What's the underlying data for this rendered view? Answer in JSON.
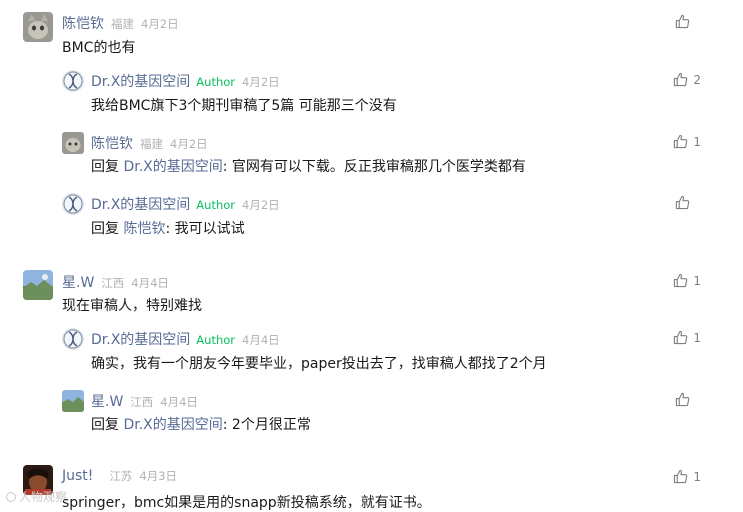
{
  "comments": [
    {
      "name": "陈恺钦",
      "location": "福建",
      "date": "4月2日",
      "text": "BMC的也有",
      "likes": "",
      "replies": [
        {
          "name": "Dr.X的基因空间",
          "author": "Author",
          "date": "4月2日",
          "text": "我给BMC旗下3个期刊审稿了5篇 可能那三个没有",
          "likes": "2"
        },
        {
          "name": "陈恺钦",
          "location": "福建",
          "date": "4月2日",
          "reply_prefix": "回复 ",
          "reply_to": "Dr.X的基因空间",
          "text": ": 官网有可以下载。反正我审稿那几个医学类都有",
          "likes": "1"
        },
        {
          "name": "Dr.X的基因空间",
          "author": "Author",
          "date": "4月2日",
          "reply_prefix": "回复 ",
          "reply_to": "陈恺钦",
          "text": ": 我可以试试",
          "likes": ""
        }
      ]
    },
    {
      "name": "星.W",
      "location": "江西",
      "date": "4月4日",
      "text": "现在审稿人，特别难找",
      "likes": "1",
      "replies": [
        {
          "name": "Dr.X的基因空间",
          "author": "Author",
          "date": "4月4日",
          "text": "确实，我有一个朋友今年要毕业，paper投出去了，找审稿人都找了2个月",
          "likes": "1"
        },
        {
          "name": "星.W",
          "location": "江西",
          "date": "4月4日",
          "reply_prefix": "回复 ",
          "reply_to": "Dr.X的基因空间",
          "text": ": 2个月很正常",
          "likes": ""
        }
      ]
    },
    {
      "name": "Just!",
      "location": "江苏",
      "date": "4月3日",
      "text": "springer，bmc如果是用的snapp新投稿系统，就有证书。",
      "likes": "1"
    }
  ],
  "watermark": "人物观察",
  "colors": {
    "name": "#576b95",
    "author": "#07c160",
    "meta": "#b2b2b2",
    "icon": "#7f7f7f"
  },
  "icons": {
    "like": "thumbs-up-icon"
  }
}
